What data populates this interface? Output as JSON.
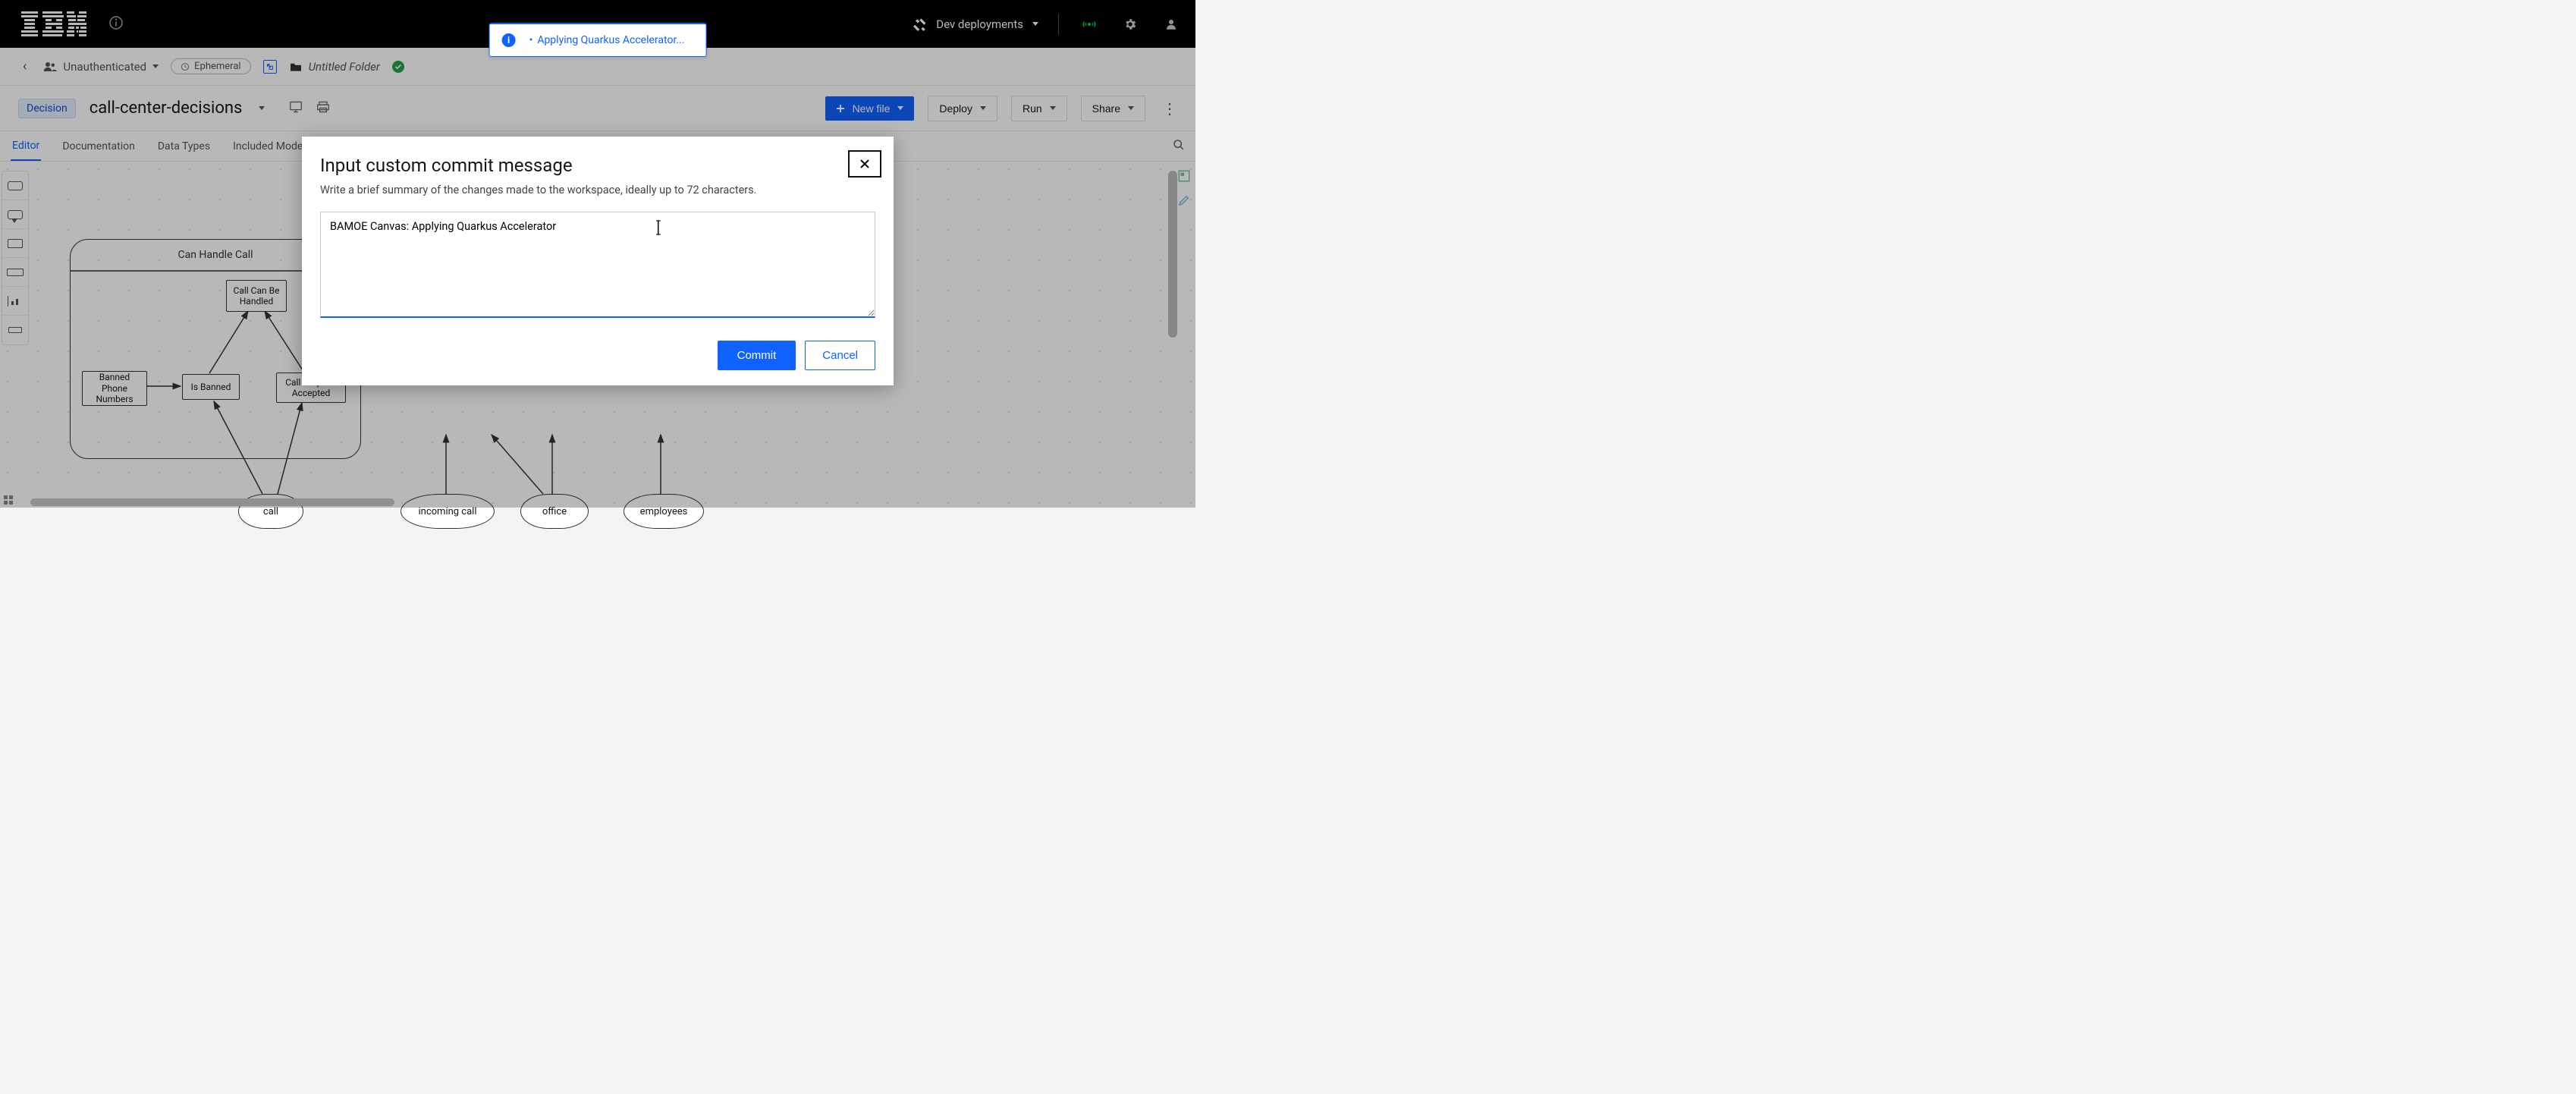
{
  "topbar": {
    "dev_deployments": "Dev deployments"
  },
  "status_toast": {
    "text": "Applying Quarkus Accelerator..."
  },
  "breadcrumb": {
    "auth_user": "Unauthenticated",
    "ephemeral": "Ephemeral",
    "folder_name": "Untitled Folder"
  },
  "title": {
    "badge": "Decision",
    "file_name": "call-center-decisions",
    "new_file": "New file",
    "deploy": "Deploy",
    "run": "Run",
    "share": "Share"
  },
  "tabs": {
    "items": [
      "Editor",
      "Documentation",
      "Data Types",
      "Included Models"
    ],
    "active_index": 0
  },
  "diagram": {
    "group_title": "Can Handle Call",
    "nodes": {
      "call_can_be_handled": "Call Can Be\nHandled",
      "banned_phone_numbers": "Banned\nPhone\nNumbers",
      "is_banned": "Is Banned",
      "call_purpose_accepted": "Call Purpose\nAccepted"
    },
    "ovals": {
      "call": "call",
      "incoming_call": "incoming call",
      "office": "office",
      "employees": "employees"
    }
  },
  "modal": {
    "title": "Input custom commit message",
    "subtitle": "Write a brief summary of the changes made to the workspace, ideally up to 72 characters.",
    "textarea_value": "BAMOE Canvas: Applying Quarkus Accelerator",
    "commit": "Commit",
    "cancel": "Cancel"
  }
}
